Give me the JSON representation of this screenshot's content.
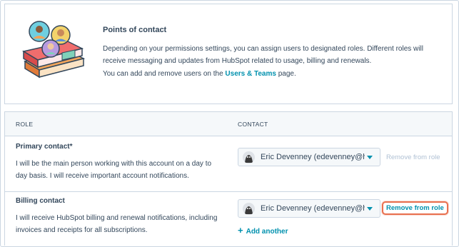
{
  "info": {
    "title": "Points of contact",
    "body": "Depending on your permissions settings, you can assign users to designated roles. Different roles will receive messaging and updates from HubSpot related to usage, billing and renewals.",
    "body2_prefix": "You can add and remove users on the ",
    "body2_link": "Users & Teams",
    "body2_suffix": " page."
  },
  "table": {
    "columns": [
      "ROLE",
      "CONTACT"
    ],
    "rows": [
      {
        "title": "Primary contact*",
        "description": "I will be the main person working with this account on a day to day basis. I will receive important account notifications.",
        "contact": "Eric Devenney (edevenney@hubspot.com)",
        "remove_label": "Remove from role"
      },
      {
        "title": "Billing contact",
        "description": "I will receive HubSpot billing and renewal notifications, including invoices and receipts for all subscriptions.",
        "contact": "Eric Devenney (edevenney@hubspot.com)",
        "remove_label": "Remove from role",
        "add_label": "Add another"
      }
    ]
  },
  "colors": {
    "accent": "#0091ae",
    "text": "#33475b",
    "border": "#cbd6e2",
    "highlight": "#e8704f",
    "disabled": "#b0c1d4"
  },
  "icons": [
    "book-stack-illustration-icon",
    "avatar-icon",
    "chevron-down-icon",
    "plus-icon"
  ]
}
